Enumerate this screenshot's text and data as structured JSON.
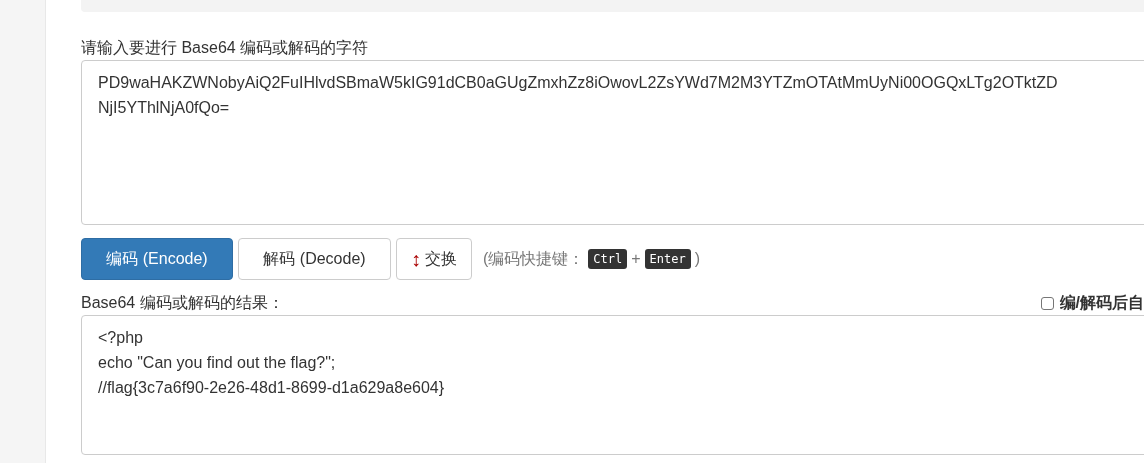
{
  "input_label": "请输入要进行 Base64 编码或解码的字符",
  "input_field": {
    "value": "PD9waHAKZWNobyAiQ2FuIHlvdSBmaW5kIG91dCB0aGUgZmxhZz8iOwovL2ZsYWd7M2M3YTZmOTAtMmUyNi00OGQxLTg2OTktZD\nNjI5YThlNjA0fQo="
  },
  "buttons": [
    {
      "kind": "primary",
      "label": "编码 (Encode)"
    },
    {
      "kind": "default",
      "label": "解码 (Decode)"
    },
    {
      "kind": "swap",
      "icon": "↕",
      "label": "交换"
    }
  ],
  "shortcut_hint": {
    "prefix": "(编码快捷键：",
    "keys": [
      "Ctrl",
      "Enter"
    ],
    "joiner": "+",
    "suffix": ")"
  },
  "result_label": "Base64 编码或解码的结果：",
  "auto_option": {
    "label": "编/解码后自",
    "checked": false
  },
  "result_field": {
    "value": "<?php\necho \"Can you find out the flag?\";\n//flag{3c7a6f90-2e26-48d1-8699-d1a629a8e604}"
  }
}
